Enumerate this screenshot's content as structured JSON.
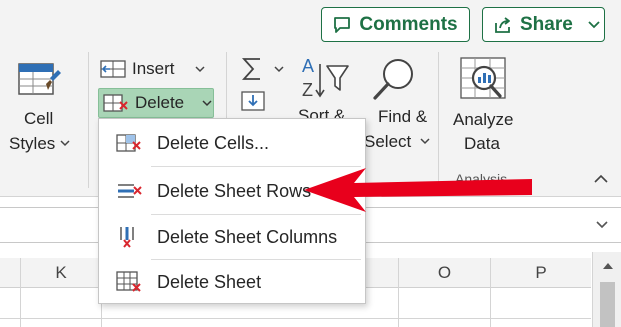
{
  "header": {
    "comments_label": "Comments",
    "share_label": "Share"
  },
  "ribbon": {
    "cell_styles": {
      "line1": "Cell",
      "line2": "Styles"
    },
    "insert_label": "Insert",
    "delete_label": "Delete",
    "sort_label": "Sort &",
    "find_select": {
      "line1": "Find &",
      "line2": "Select"
    },
    "analyze": {
      "line1": "Analyze",
      "line2": "Data"
    },
    "analysis_group_label": "Analysis"
  },
  "delete_menu": {
    "items": [
      {
        "label": "Delete Cells...",
        "icon": "delete-cells-icon"
      },
      {
        "label": "Delete Sheet Rows",
        "icon": "delete-rows-icon"
      },
      {
        "label": "Delete Sheet Columns",
        "icon": "delete-columns-icon"
      },
      {
        "label": "Delete Sheet",
        "icon": "delete-sheet-icon"
      }
    ]
  },
  "grid": {
    "columns": [
      "K",
      "O",
      "P"
    ]
  },
  "colors": {
    "accent": "#1e7145",
    "delete_highlight": "#a9d5b6",
    "arrow": "#e8001c",
    "icon_red": "#d9262e",
    "icon_blue": "#2f6fb5"
  }
}
